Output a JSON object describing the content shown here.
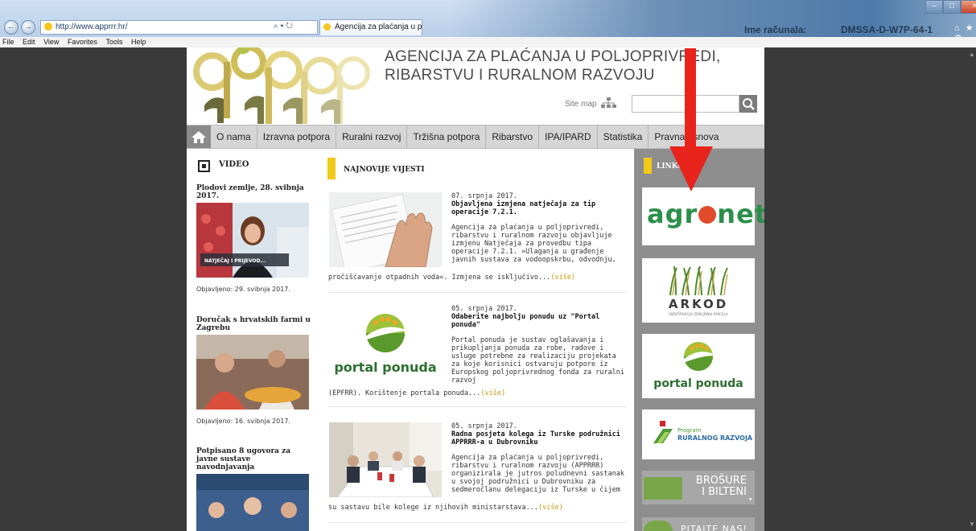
{
  "browser": {
    "address": "http://www.apprrr.hr/",
    "address_controls": "⌕ ▾ ↻",
    "tab_title": "Agencija za plaćanja u polj...",
    "tab_close": "×",
    "computer_label": "Ime računala:",
    "computer_name": "DMSSA-D-W7P-64-1",
    "window_buttons": {
      "minimize": "–",
      "maximize": "□",
      "close": "×"
    },
    "toolbar_icons": "⌂ ★ ⚙",
    "menu": [
      "File",
      "Edit",
      "View",
      "Favorites",
      "Tools",
      "Help"
    ]
  },
  "site": {
    "title_line1": "AGENCIJA ZA PLAĆANJA U POLJOPRIVREDI,",
    "title_line2": "RIBARSTVU I RURALNOM RAZVOJU",
    "site_map": "Site map",
    "nav": [
      "O nama",
      "Izravna potpora",
      "Ruralni razvoj",
      "Tržišna potpora",
      "Ribarstvo",
      "IPA/IPARD",
      "Statistika",
      "Pravna osnova"
    ]
  },
  "video": {
    "heading": "VIDEO",
    "items": [
      {
        "title": "Plodovi zemlje, 28. svibnja 2017.",
        "caption": "NATJEČAJ I PRIJEVOD...",
        "date": "Objavljeno: 29. svibnja 2017."
      },
      {
        "title": "Doručak s hrvatskih farmi u Zagrebu",
        "date": "Objavljeno: 16. svibnja 2017."
      },
      {
        "title": "Potpisano 8 ugovora za javne sustave navodnjavanja"
      }
    ]
  },
  "news": {
    "heading": "NAJNOVIJE VIJESTI",
    "more_label": "(više)",
    "items": [
      {
        "date": "07. srpnja 2017.",
        "title": "Objavljena izmjena natječaja za tip operacije 7.2.1.",
        "text": "Agencija za plaćanja u poljoprivredi, ribarstvu i ruralnom razvoju objavljuje izmjenu Natječaja za provedbu tipa operacije 7.2.1. »Ulaganja u građenje javnih sustava za vodoopskrbu, odvodnju,",
        "tail": "pročišćavanje otpadnih voda«. Izmjena se isključivo..."
      },
      {
        "date": "05. srpnja 2017.",
        "title": "Odaberite najbolju ponudu uz \"Portal ponuda\"",
        "text": "Portal ponuda je sustav oglašavanja i prikupljanja ponuda za robe, radove i usluge potrebne za realizaciju projekata za koje korisnici ostvaruju potpore iz Europskog poljoprivrednog fonda za ruralni razvoj",
        "tail": "(EPFRR). Korištenje portala ponuda...",
        "thumb_text": "portal ponuda"
      },
      {
        "date": "05. srpnja 2017.",
        "title": "Radna posjeta kolega iz Turske podružnici APPRRR-a u Dubrovniku",
        "text": "Agencija za plaćanja u poljoprivredi, ribarstvu i ruralnom razvoju (APPRRR) organizirala je jutros poludnevni sastanak u svojoj podružnici u Dubrovniku za sedmeročlanu delegaciju iz Turske u čijem",
        "tail": "su sastavu bile kolege iz njihovih ministarstava..."
      }
    ]
  },
  "links": {
    "heading": "LINKOVI",
    "agronet": {
      "pre": "agr",
      "post": "net"
    },
    "arkod": {
      "name": "ARKOD",
      "sub": "IDENTIFIKACIJA ZEMLJIŠNIH PARCELA"
    },
    "portal": "portal ponuda",
    "program": {
      "line1": "Program",
      "line2": "RURALNOG RAZVOJA"
    },
    "brosure": {
      "line1": "BROŠURE",
      "line2": "I BILTENI"
    },
    "pitajte": "PITAJTE NAS!"
  },
  "colors": {
    "accent_yellow": "#f2c916",
    "more_link": "#c99a10",
    "nav_bg": "#d6d6d6",
    "right_col_bg": "#8e8e8e",
    "agronet_green": "#2c8f4b",
    "annotation_arrow": "#e8231c"
  }
}
